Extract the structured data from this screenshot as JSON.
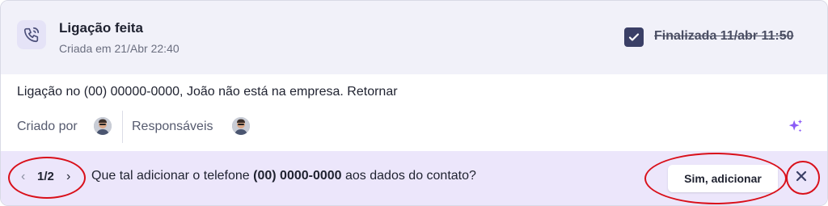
{
  "task": {
    "title": "Ligação feita",
    "created": "Criada em 21/Abr 22:40",
    "status": "Finalizada 11/abr 11:50",
    "completed": true,
    "description": "Ligação no (00) 00000-0000, João não está na empresa. Retornar",
    "created_by_label": "Criado por",
    "responsible_label": "Responsáveis"
  },
  "suggestion": {
    "pager": "1/2",
    "text_before": "Que tal adicionar o telefone ",
    "phone": "(00) 0000-0000",
    "text_after": " aos dados do contato?",
    "accept_label": "Sim, adicionar"
  },
  "icons": {
    "header": "phone-call-icon",
    "check": "check-icon",
    "ai": "sparkle-icon",
    "prev": "chevron-left-icon",
    "next": "chevron-right-icon",
    "close": "close-icon"
  },
  "colors": {
    "header_bg": "#f1f1f9",
    "footer_bg": "#ece6fb",
    "accent": "#3a3f66",
    "sparkle": "#8b5cf6",
    "highlight_ring": "#d9101a"
  }
}
